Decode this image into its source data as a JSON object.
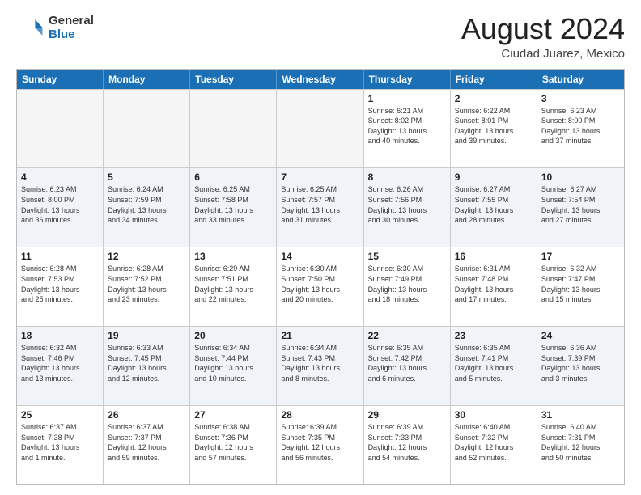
{
  "header": {
    "logo_general": "General",
    "logo_blue": "Blue",
    "month_year": "August 2024",
    "location": "Ciudad Juarez, Mexico"
  },
  "days": [
    "Sunday",
    "Monday",
    "Tuesday",
    "Wednesday",
    "Thursday",
    "Friday",
    "Saturday"
  ],
  "rows": [
    [
      {
        "date": "",
        "info": ""
      },
      {
        "date": "",
        "info": ""
      },
      {
        "date": "",
        "info": ""
      },
      {
        "date": "",
        "info": ""
      },
      {
        "date": "1",
        "info": "Sunrise: 6:21 AM\nSunset: 8:02 PM\nDaylight: 13 hours\nand 40 minutes."
      },
      {
        "date": "2",
        "info": "Sunrise: 6:22 AM\nSunset: 8:01 PM\nDaylight: 13 hours\nand 39 minutes."
      },
      {
        "date": "3",
        "info": "Sunrise: 6:23 AM\nSunset: 8:00 PM\nDaylight: 13 hours\nand 37 minutes."
      }
    ],
    [
      {
        "date": "4",
        "info": "Sunrise: 6:23 AM\nSunset: 8:00 PM\nDaylight: 13 hours\nand 36 minutes."
      },
      {
        "date": "5",
        "info": "Sunrise: 6:24 AM\nSunset: 7:59 PM\nDaylight: 13 hours\nand 34 minutes."
      },
      {
        "date": "6",
        "info": "Sunrise: 6:25 AM\nSunset: 7:58 PM\nDaylight: 13 hours\nand 33 minutes."
      },
      {
        "date": "7",
        "info": "Sunrise: 6:25 AM\nSunset: 7:57 PM\nDaylight: 13 hours\nand 31 minutes."
      },
      {
        "date": "8",
        "info": "Sunrise: 6:26 AM\nSunset: 7:56 PM\nDaylight: 13 hours\nand 30 minutes."
      },
      {
        "date": "9",
        "info": "Sunrise: 6:27 AM\nSunset: 7:55 PM\nDaylight: 13 hours\nand 28 minutes."
      },
      {
        "date": "10",
        "info": "Sunrise: 6:27 AM\nSunset: 7:54 PM\nDaylight: 13 hours\nand 27 minutes."
      }
    ],
    [
      {
        "date": "11",
        "info": "Sunrise: 6:28 AM\nSunset: 7:53 PM\nDaylight: 13 hours\nand 25 minutes."
      },
      {
        "date": "12",
        "info": "Sunrise: 6:28 AM\nSunset: 7:52 PM\nDaylight: 13 hours\nand 23 minutes."
      },
      {
        "date": "13",
        "info": "Sunrise: 6:29 AM\nSunset: 7:51 PM\nDaylight: 13 hours\nand 22 minutes."
      },
      {
        "date": "14",
        "info": "Sunrise: 6:30 AM\nSunset: 7:50 PM\nDaylight: 13 hours\nand 20 minutes."
      },
      {
        "date": "15",
        "info": "Sunrise: 6:30 AM\nSunset: 7:49 PM\nDaylight: 13 hours\nand 18 minutes."
      },
      {
        "date": "16",
        "info": "Sunrise: 6:31 AM\nSunset: 7:48 PM\nDaylight: 13 hours\nand 17 minutes."
      },
      {
        "date": "17",
        "info": "Sunrise: 6:32 AM\nSunset: 7:47 PM\nDaylight: 13 hours\nand 15 minutes."
      }
    ],
    [
      {
        "date": "18",
        "info": "Sunrise: 6:32 AM\nSunset: 7:46 PM\nDaylight: 13 hours\nand 13 minutes."
      },
      {
        "date": "19",
        "info": "Sunrise: 6:33 AM\nSunset: 7:45 PM\nDaylight: 13 hours\nand 12 minutes."
      },
      {
        "date": "20",
        "info": "Sunrise: 6:34 AM\nSunset: 7:44 PM\nDaylight: 13 hours\nand 10 minutes."
      },
      {
        "date": "21",
        "info": "Sunrise: 6:34 AM\nSunset: 7:43 PM\nDaylight: 13 hours\nand 8 minutes."
      },
      {
        "date": "22",
        "info": "Sunrise: 6:35 AM\nSunset: 7:42 PM\nDaylight: 13 hours\nand 6 minutes."
      },
      {
        "date": "23",
        "info": "Sunrise: 6:35 AM\nSunset: 7:41 PM\nDaylight: 13 hours\nand 5 minutes."
      },
      {
        "date": "24",
        "info": "Sunrise: 6:36 AM\nSunset: 7:39 PM\nDaylight: 13 hours\nand 3 minutes."
      }
    ],
    [
      {
        "date": "25",
        "info": "Sunrise: 6:37 AM\nSunset: 7:38 PM\nDaylight: 13 hours\nand 1 minute."
      },
      {
        "date": "26",
        "info": "Sunrise: 6:37 AM\nSunset: 7:37 PM\nDaylight: 12 hours\nand 59 minutes."
      },
      {
        "date": "27",
        "info": "Sunrise: 6:38 AM\nSunset: 7:36 PM\nDaylight: 12 hours\nand 57 minutes."
      },
      {
        "date": "28",
        "info": "Sunrise: 6:39 AM\nSunset: 7:35 PM\nDaylight: 12 hours\nand 56 minutes."
      },
      {
        "date": "29",
        "info": "Sunrise: 6:39 AM\nSunset: 7:33 PM\nDaylight: 12 hours\nand 54 minutes."
      },
      {
        "date": "30",
        "info": "Sunrise: 6:40 AM\nSunset: 7:32 PM\nDaylight: 12 hours\nand 52 minutes."
      },
      {
        "date": "31",
        "info": "Sunrise: 6:40 AM\nSunset: 7:31 PM\nDaylight: 12 hours\nand 50 minutes."
      }
    ]
  ]
}
